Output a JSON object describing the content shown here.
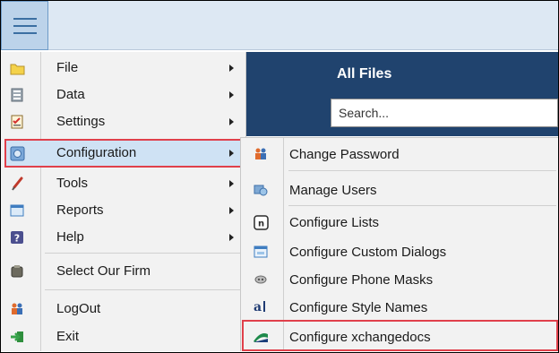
{
  "header": {
    "menu_button": "hamburger-menu",
    "panel_title": "All Files",
    "search_placeholder": "Search..."
  },
  "main_menu": {
    "items": [
      {
        "label": "File",
        "icon": "folder-icon",
        "has_submenu": true
      },
      {
        "label": "Data",
        "icon": "database-icon",
        "has_submenu": true
      },
      {
        "label": "Settings",
        "icon": "checklist-icon",
        "has_submenu": true
      },
      {
        "label": "Configuration",
        "icon": "configuration-icon",
        "has_submenu": true,
        "selected": true
      },
      {
        "label": "Tools",
        "icon": "brush-icon",
        "has_submenu": true
      },
      {
        "label": "Reports",
        "icon": "report-icon",
        "has_submenu": true
      },
      {
        "label": "Help",
        "icon": "help-icon",
        "has_submenu": true
      },
      {
        "label": "Select Our Firm",
        "icon": "firm-icon",
        "has_submenu": false
      },
      {
        "label": "LogOut",
        "icon": "logout-icon",
        "has_submenu": false
      },
      {
        "label": "Exit",
        "icon": "exit-icon",
        "has_submenu": false
      }
    ]
  },
  "config_submenu": {
    "items": [
      {
        "label": "Change Password",
        "icon": "users-key-icon"
      },
      {
        "label": "Manage Users",
        "icon": "manage-users-icon"
      },
      {
        "label": "Configure Lists",
        "icon": "list-icon"
      },
      {
        "label": "Configure Custom Dialogs",
        "icon": "dialog-icon"
      },
      {
        "label": "Configure Phone Masks",
        "icon": "phone-mask-icon"
      },
      {
        "label": "Configure Style Names",
        "icon": "style-names-icon"
      },
      {
        "label": "Configure xchangedocs",
        "icon": "xchangedocs-icon",
        "highlighted": true
      }
    ]
  },
  "colors": {
    "accent_header": "#20436e",
    "highlight_border": "#e0404b",
    "selection_fill": "#cfe2f4",
    "titlebar": "#dde8f3"
  }
}
